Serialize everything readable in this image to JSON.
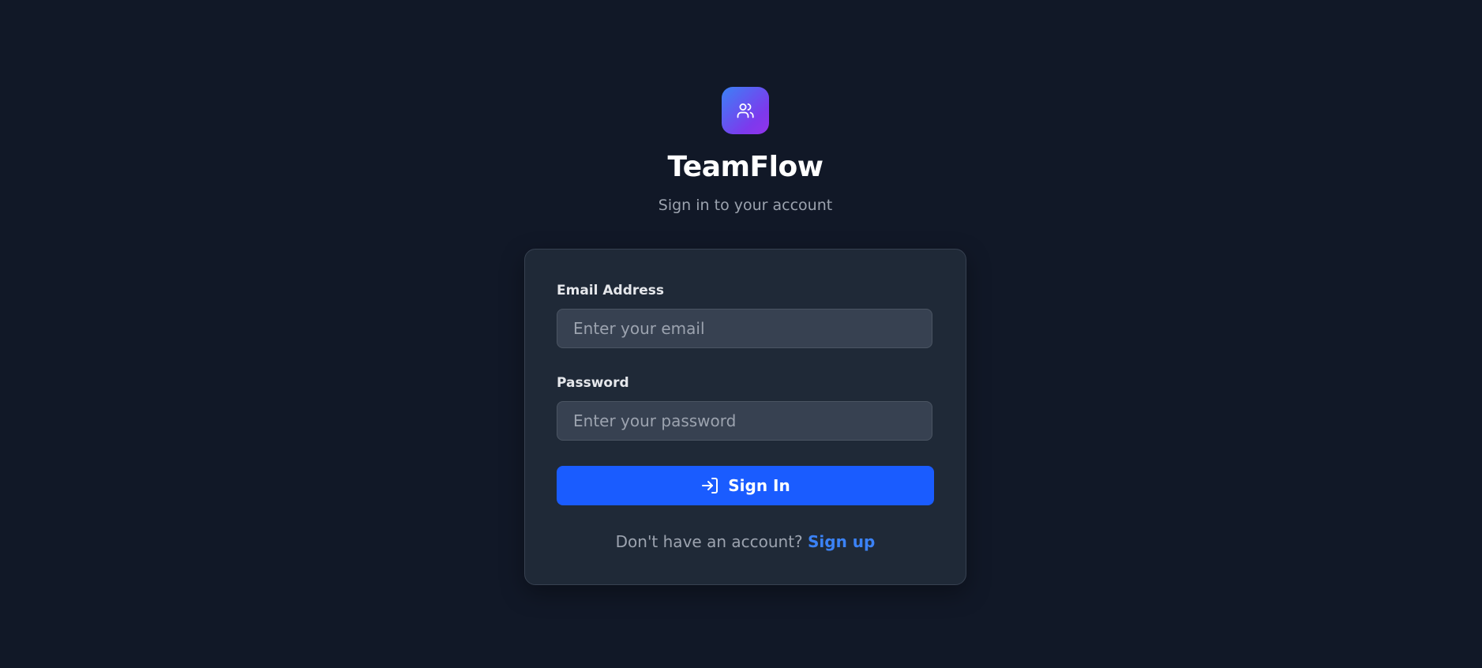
{
  "app": {
    "name": "TeamFlow",
    "subtitle": "Sign in to your account",
    "logo_icon": "users-icon",
    "accent_gradient": [
      "#3b82f6",
      "#9333ea"
    ]
  },
  "form": {
    "email": {
      "label": "Email Address",
      "placeholder": "Enter your email",
      "value": ""
    },
    "password": {
      "label": "Password",
      "placeholder": "Enter your password",
      "value": ""
    },
    "submit": {
      "label": "Sign In",
      "icon": "log-in-icon",
      "color": "#1a5cff"
    }
  },
  "footer": {
    "prompt": "Don't have an account?",
    "link": "Sign up",
    "link_color": "#3b82f6"
  },
  "colors": {
    "background": "#111827",
    "card": "#1f2937",
    "input": "#374151"
  }
}
